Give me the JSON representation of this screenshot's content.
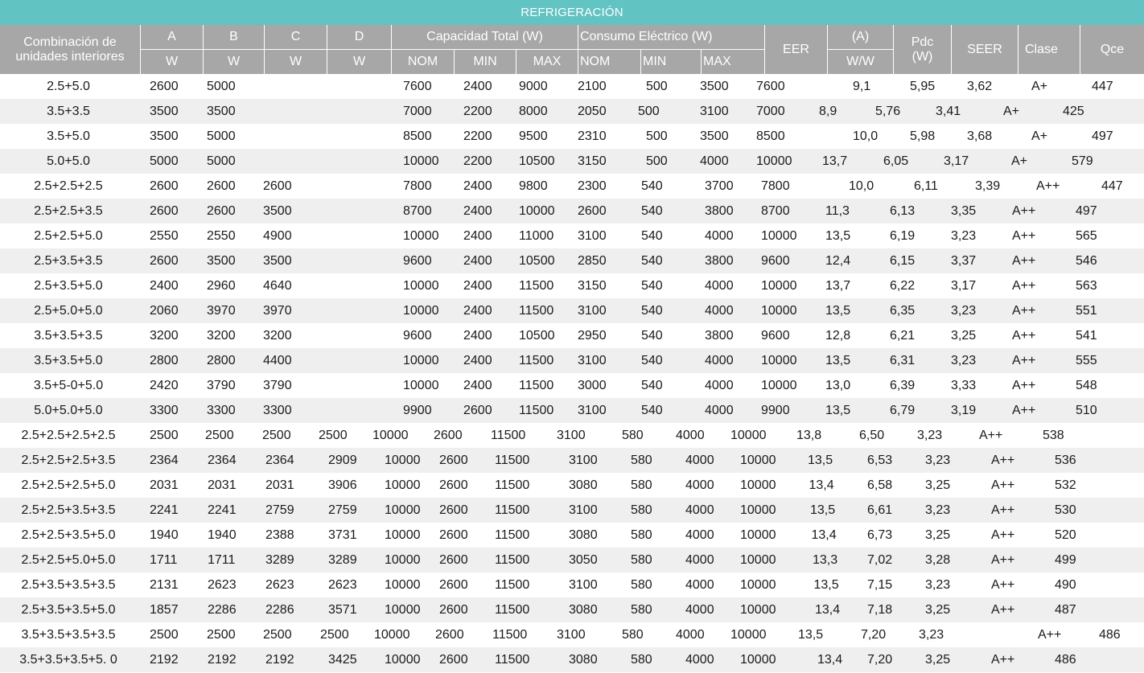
{
  "title": "REFRIGERACIÓN",
  "header": {
    "combo": "Combinación de unidades interiores",
    "A": "A",
    "B": "B",
    "C": "C",
    "D": "D",
    "unit_w": "W",
    "capacidad": "Capacidad Total (W)",
    "consumo": "Consumo Eléctrico (W)",
    "nom": "NOM",
    "min": "MIN",
    "max": "MAX",
    "eer": "EER",
    "amp": "(A)",
    "ww": "W/W",
    "pdc": "Pdc (W)",
    "seer": "SEER",
    "clase": "Clase",
    "qce": "Qce"
  },
  "rows": [
    {
      "c": [
        "2.5+5.0",
        "2600",
        "5000",
        "",
        "",
        "7600",
        "2400",
        "9000",
        "2100",
        "500",
        "3500",
        "7600",
        "9,1",
        "5,95",
        "3,62",
        "A+",
        "447"
      ]
    },
    {
      "c": [
        "3.5+3.5",
        "3500",
        "3500",
        "",
        "",
        "7000",
        "2200",
        "8000",
        "2050",
        "500",
        "3100",
        "7000",
        "8,9",
        "5,76",
        "3,41",
        "A+",
        "425"
      ]
    },
    {
      "c": [
        "3.5+5.0",
        "3500",
        "5000",
        "",
        "",
        "8500",
        "2200",
        "9500",
        "2310",
        "500",
        "3500",
        "8500",
        "10,0",
        "5,98",
        "3,68",
        "A+",
        "497"
      ]
    },
    {
      "c": [
        "5.0+5.0",
        "5000",
        "5000",
        "",
        "",
        "10000",
        "2200",
        "10500",
        "3150",
        "500",
        "4000",
        "10000",
        "13,7",
        "6,05",
        "3,17",
        "A+",
        "579"
      ]
    },
    {
      "c": [
        "2.5+2.5+2.5",
        "2600",
        "2600",
        "2600",
        "",
        "7800",
        "2400",
        "9800",
        "2300",
        "540",
        "3700",
        "7800",
        "10,0",
        "6,11",
        "3,39",
        "A++",
        "447"
      ]
    },
    {
      "c": [
        "2.5+2.5+3.5",
        "2600",
        "2600",
        "3500",
        "",
        "8700",
        "2400",
        "10000",
        "2600",
        "540",
        "3800",
        "8700",
        "11,3",
        "6,13",
        "3,35",
        "A++",
        "497"
      ]
    },
    {
      "c": [
        "2.5+2.5+5.0",
        "2550",
        "2550",
        "4900",
        "",
        "10000",
        "2400",
        "11000",
        "3100",
        "540",
        "4000",
        "10000",
        "13,5",
        "6,19",
        "3,23",
        "A++",
        "565"
      ]
    },
    {
      "c": [
        "2.5+3.5+3.5",
        "2600",
        "3500",
        "3500",
        "",
        "9600",
        "2400",
        "10500",
        "2850",
        "540",
        "3800",
        "9600",
        "12,4",
        "6,15",
        "3,37",
        "A++",
        "546"
      ]
    },
    {
      "c": [
        "2.5+3.5+5.0",
        "2400",
        "2960",
        "4640",
        "",
        "10000",
        "2400",
        "11500",
        "3150",
        "540",
        "4000",
        "10000",
        "13,7",
        "6,22",
        "3,17",
        "A++",
        "563"
      ]
    },
    {
      "c": [
        "2.5+5.0+5.0",
        "2060",
        "3970",
        "3970",
        "",
        "10000",
        "2400",
        "11500",
        "3100",
        "540",
        "4000",
        "10000",
        "13,5",
        "6,35",
        "3,23",
        "A++",
        "551"
      ]
    },
    {
      "c": [
        "3.5+3.5+3.5",
        "3200",
        "3200",
        "3200",
        "",
        "9600",
        "2400",
        "10500",
        "2950",
        "540",
        "3800",
        "9600",
        "12,8",
        "6,21",
        "3,25",
        "A++",
        "541"
      ]
    },
    {
      "c": [
        "3.5+3.5+5.0",
        "2800",
        "2800",
        "4400",
        "",
        "10000",
        "2400",
        "11500",
        "3100",
        "540",
        "4000",
        "10000",
        "13,5",
        "6,31",
        "3,23",
        "A++",
        "555"
      ]
    },
    {
      "c": [
        "3.5+5-0+5.0",
        "2420",
        "3790",
        "3790",
        "",
        "10000",
        "2400",
        "11500",
        "3000",
        "540",
        "4000",
        "10000",
        "13,0",
        "6,39",
        "3,33",
        "A++",
        "548"
      ]
    },
    {
      "c": [
        "5.0+5.0+5.0",
        "3300",
        "3300",
        "3300",
        "",
        "9900",
        "2600",
        "11500",
        "3100",
        "540",
        "4000",
        "9900",
        "13,5",
        "6,79",
        "3,19",
        "A++",
        "510"
      ]
    },
    {
      "c": [
        "2.5+2.5+2.5+2.5",
        "2500",
        "2500",
        "2500",
        "2500",
        "10000",
        "2600",
        "11500",
        "3100",
        "580",
        "4000",
        "10000",
        "13,8",
        "6,50",
        "3,23",
        "A++",
        "538"
      ]
    },
    {
      "c": [
        "2.5+2.5+2.5+3.5",
        "2364",
        "2364",
        "2364",
        "2909",
        "10000",
        "2600",
        "11500",
        "3100",
        "580",
        "4000",
        "10000",
        "13,5",
        "6,53",
        "3,23",
        "A++",
        "536"
      ]
    },
    {
      "c": [
        "2.5+2.5+2.5+5.0",
        "2031",
        "2031",
        "2031",
        "3906",
        "10000",
        "2600",
        "11500",
        "3080",
        "580",
        "4000",
        "10000",
        "13,4",
        "6,58",
        "3,25",
        "A++",
        "532"
      ]
    },
    {
      "c": [
        "2.5+2.5+3.5+3.5",
        "2241",
        "2241",
        "2759",
        "2759",
        "10000",
        "2600",
        "11500",
        "3100",
        "580",
        "4000",
        "10000",
        "13,5",
        "6,61",
        "3,23",
        "A++",
        "530"
      ]
    },
    {
      "c": [
        "2.5+2.5+3.5+5.0",
        "1940",
        "1940",
        "2388",
        "3731",
        "10000",
        "2600",
        "11500",
        "3080",
        "580",
        "4000",
        "10000",
        "13,4",
        "6,73",
        "3,25",
        "A++",
        "520"
      ]
    },
    {
      "c": [
        "2.5+2.5+5.0+5.0",
        "1711",
        "1711",
        "3289",
        "3289",
        "10000",
        "2600",
        "11500",
        "3050",
        "580",
        "4000",
        "10000",
        "13,3",
        "7,02",
        "3,28",
        "A++",
        "499"
      ]
    },
    {
      "c": [
        "2.5+3.5+3.5+3.5",
        "2131",
        "2623",
        "2623",
        "2623",
        "10000",
        "2600",
        "11500",
        "3100",
        "580",
        "4000",
        "10000",
        "13,5",
        "7,15",
        "3,23",
        "A++",
        "490"
      ]
    },
    {
      "c": [
        "2.5+3.5+3.5+5.0",
        "1857",
        "2286",
        "2286",
        "3571",
        "10000",
        "2600",
        "11500",
        "3080",
        "580",
        "4000",
        "10000",
        "13,4",
        "7,18",
        "3,25",
        "A++",
        "487"
      ]
    },
    {
      "c": [
        "3.5+3.5+3.5+3.5",
        "2500",
        "2500",
        "2500",
        "2500",
        "10000",
        "2600",
        "11500",
        "3100",
        "580",
        "4000",
        "10000",
        "13,5",
        "7,20",
        "3,23",
        "A++",
        "486"
      ]
    },
    {
      "c": [
        "3.5+3.5+3.5+5. 0",
        "2192",
        "2192",
        "2192",
        "3425",
        "10000",
        "2600",
        "11500",
        "3080",
        "580",
        "4000",
        "10000",
        "13,4",
        "7,20",
        "3,25",
        "A++",
        "486"
      ]
    }
  ]
}
